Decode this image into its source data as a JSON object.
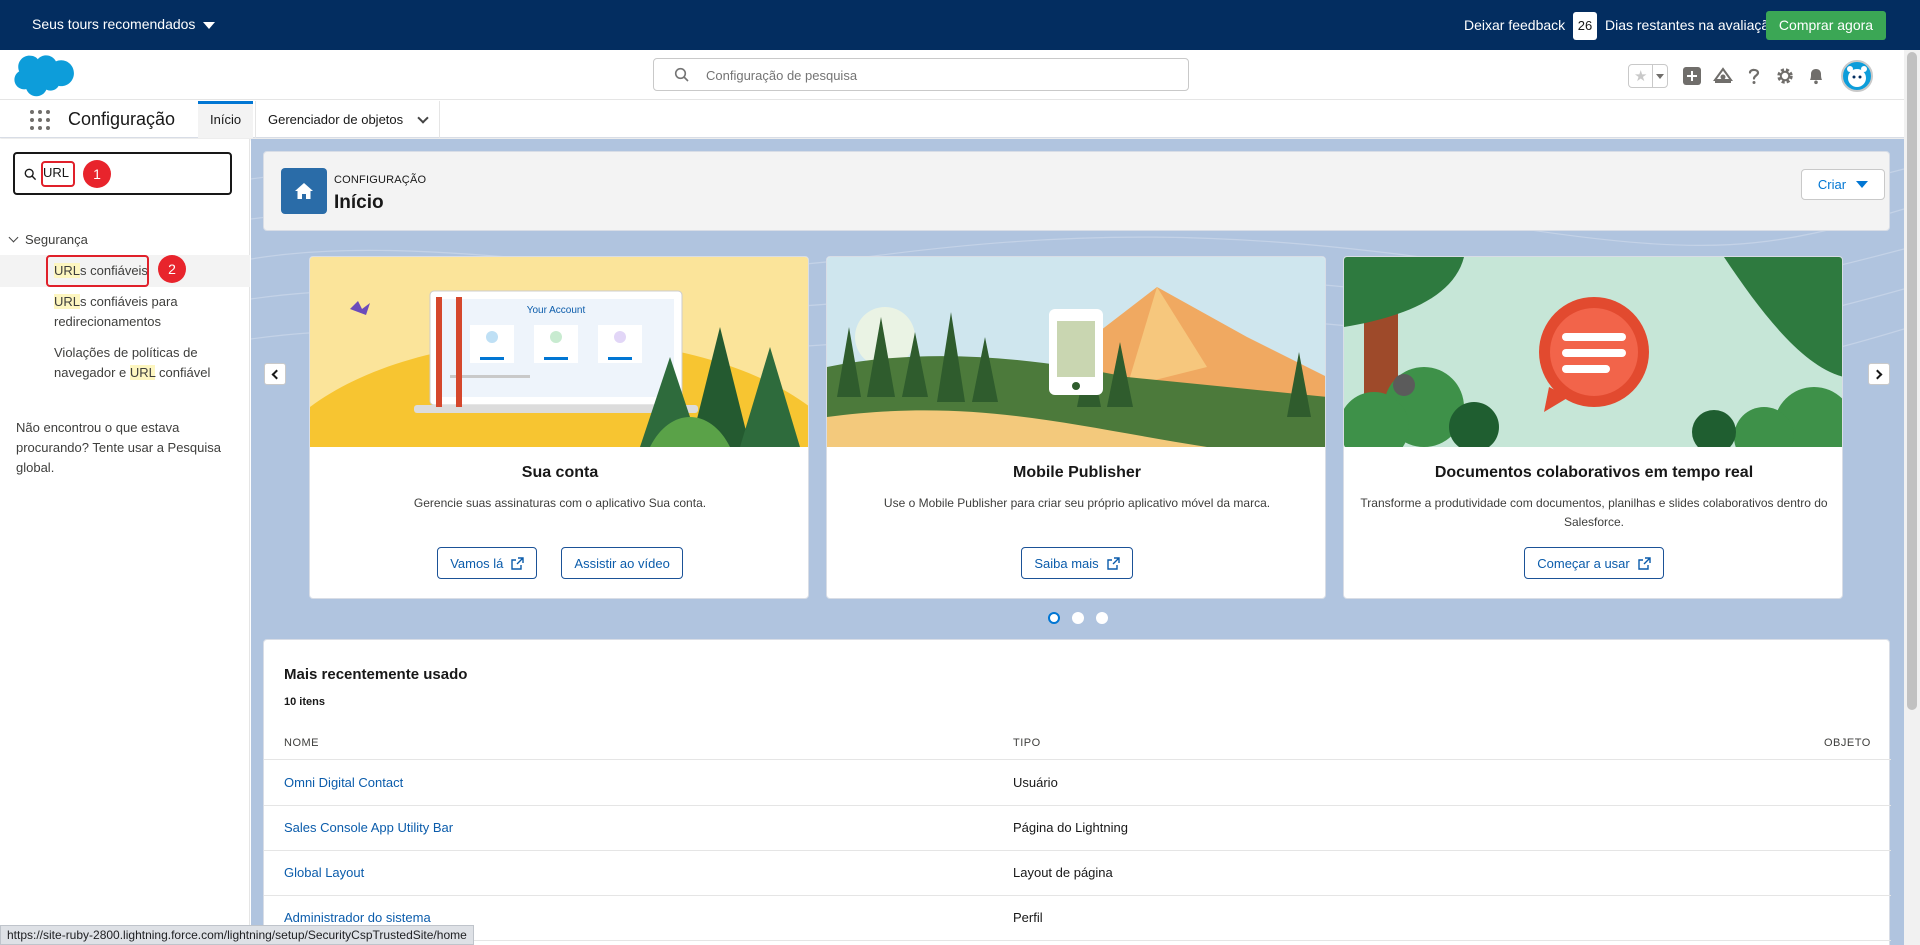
{
  "trialbar": {
    "tours_label": "Seus tours recomendados",
    "feedback_label": "Deixar feedback",
    "days_remaining": "26",
    "days_label": "Dias restantes na avaliação",
    "buy_label": "Comprar agora"
  },
  "header": {
    "search_placeholder": "Configuração de pesquisa",
    "icons": [
      "star-icon",
      "add-icon",
      "trailhead-icon",
      "help-icon",
      "gear-icon",
      "bell-icon",
      "avatar"
    ]
  },
  "appnav": {
    "app_name": "Configuração",
    "tabs": [
      {
        "label": "Início",
        "active": true
      },
      {
        "label": "Gerenciador de objetos",
        "active": false
      }
    ]
  },
  "sidebar": {
    "quickfind_value": "URL",
    "annotations": [
      "1",
      "2"
    ],
    "group_label": "Segurança",
    "items": [
      {
        "highlight": "URL",
        "rest": "s confiáveis"
      },
      {
        "highlight": "URL",
        "rest": "s confiáveis para",
        "line2": "redirecionamentos"
      },
      {
        "prefix": "Violações de políticas de",
        "line2_prefix": "navegador e ",
        "highlight": "URL",
        "rest": " confiável"
      }
    ],
    "not_found": "Não encontrou o que estava procurando? Tente usar a Pesquisa global."
  },
  "pagehead": {
    "eyebrow": "CONFIGURAÇÃO",
    "title": "Início",
    "create_label": "Criar"
  },
  "cards": [
    {
      "title": "Sua conta",
      "desc": "Gerencie suas assinaturas com o aplicativo Sua conta.",
      "art_caption": "Your Account",
      "buttons": [
        "Vamos lá",
        "Assistir ao vídeo"
      ]
    },
    {
      "title": "Mobile Publisher",
      "desc": "Use o Mobile Publisher para criar seu próprio aplicativo móvel da marca.",
      "buttons": [
        "Saiba mais"
      ]
    },
    {
      "title": "Documentos colaborativos em tempo real",
      "desc": "Transforme a produtividade com documentos, planilhas e slides colaborativos dentro do Salesforce.",
      "buttons": [
        "Começar a usar"
      ]
    }
  ],
  "carousel": {
    "pages": 3,
    "active_page": 1
  },
  "recent": {
    "title": "Mais recentemente usado",
    "count": "10 itens",
    "columns": [
      "NOME",
      "TIPO",
      "OBJETO"
    ],
    "rows": [
      {
        "name": "Omni Digital Contact",
        "type": "Usuário"
      },
      {
        "name": "Sales Console App Utility Bar",
        "type": "Página do Lightning"
      },
      {
        "name": "Global Layout",
        "type": "Layout de página"
      },
      {
        "name": "Administrador do sistema",
        "type": "Perfil"
      }
    ]
  },
  "statusbar_url": "https://site-ruby-2800.lightning.force.com/lightning/setup/SecurityCspTrustedSite/home",
  "colors": {
    "brand_navy": "#032d60",
    "brand_blue": "#0176d3",
    "buy_green": "#3ba755",
    "annotation_red": "#e8242c"
  }
}
